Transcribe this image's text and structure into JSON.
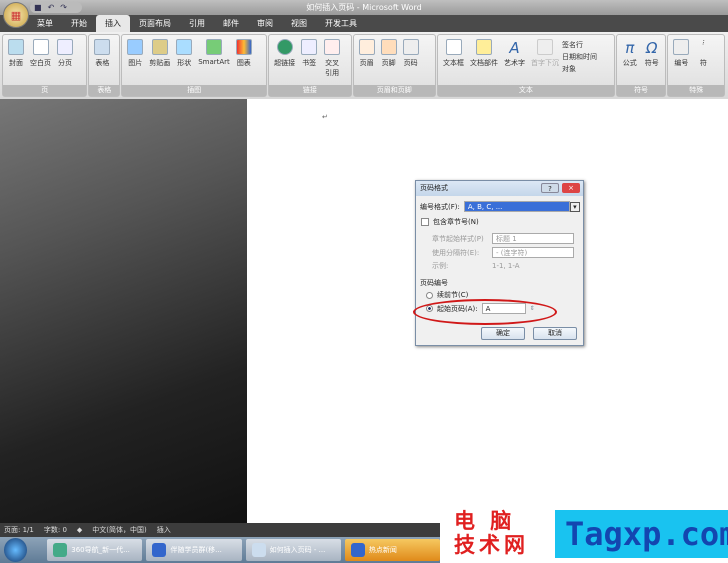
{
  "window": {
    "title": "如何插入页码 - Microsoft Word"
  },
  "quick_access": [
    "save",
    "undo",
    "redo"
  ],
  "tabs": [
    "菜单",
    "开始",
    "插入",
    "页面布局",
    "引用",
    "邮件",
    "审阅",
    "视图",
    "开发工具"
  ],
  "active_tab": "插入",
  "ribbon": {
    "groups": [
      {
        "label": "页",
        "buttons": [
          "封面",
          "空白页",
          "分页"
        ]
      },
      {
        "label": "表格",
        "buttons": [
          "表格"
        ]
      },
      {
        "label": "插图",
        "buttons": [
          "图片",
          "剪贴画",
          "形状",
          "SmartArt",
          "图表"
        ]
      },
      {
        "label": "链接",
        "buttons": [
          "超链接",
          "书签",
          "交叉引用"
        ]
      },
      {
        "label": "页眉和页脚",
        "buttons": [
          "页眉",
          "页脚",
          "页码"
        ]
      },
      {
        "label": "文本",
        "buttons": [
          "文本框",
          "文档部件",
          "艺术字",
          "首字下沉"
        ],
        "small": [
          "签名行",
          "日期和时间",
          "对象"
        ]
      },
      {
        "label": "符号",
        "buttons": [
          "公式",
          "符号",
          "编号"
        ]
      },
      {
        "label": "特殊",
        "buttons": [
          "符"
        ]
      }
    ]
  },
  "dialog": {
    "title": "页码格式",
    "help": "?",
    "close": "×",
    "number_format_label": "编号格式(F):",
    "number_format_value": "A, B, C, ...",
    "include_chapter_label": "包含章节号(N)",
    "include_chapter_checked": false,
    "chapter_style_label": "章节起始样式(P)",
    "chapter_style_value": "标题 1",
    "separator_label": "使用分隔符(E):",
    "separator_value": "-  (连字符)",
    "example_label": "示例:",
    "example_value": "1-1, 1-A",
    "numbering_section": "页码编号",
    "continue_label": "续前节(C)",
    "start_at_label": "起始页码(A):",
    "start_at_value": "A",
    "start_at_selected": true,
    "ok": "确定",
    "cancel": "取消"
  },
  "status_bar": {
    "page": "页面: 1/1",
    "words": "字数: 0",
    "language": "中文(简体，中国)",
    "mode": "插入"
  },
  "taskbar": {
    "items": [
      "360导航_新一代...",
      "伴随学员群(移...",
      "如何插入页码 - ...",
      "热点新闻"
    ],
    "active": "热点新闻"
  },
  "watermark": {
    "line1": "电 脑",
    "line2": "技术网",
    "brand": "Tagxp.com"
  }
}
